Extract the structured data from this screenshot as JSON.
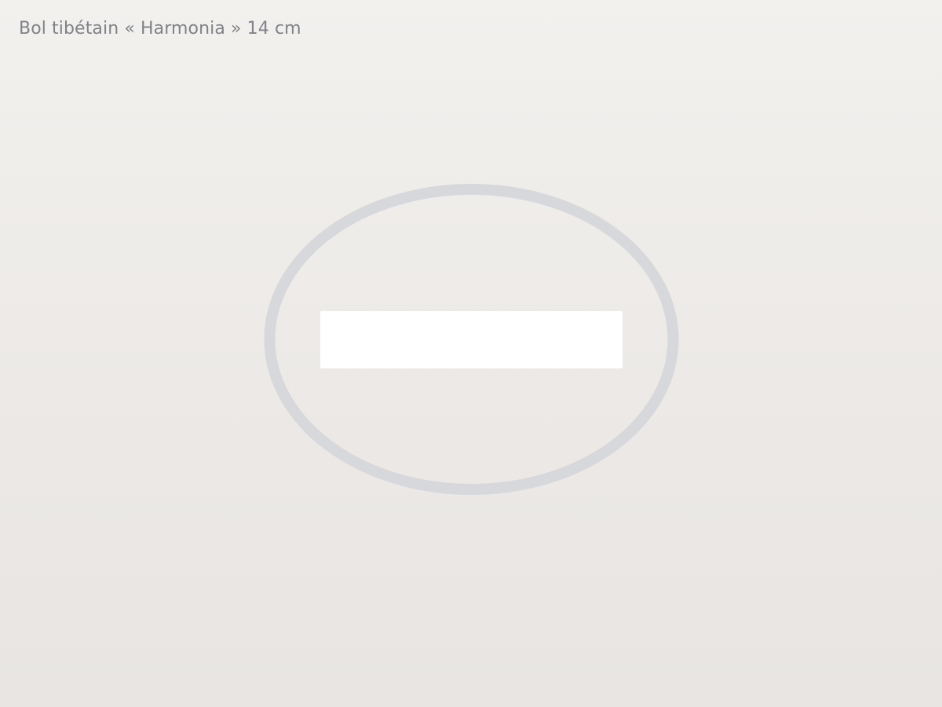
{
  "product": {
    "title": "Bol tibétain « Harmonia » 14 cm"
  },
  "image": {
    "icon": "bowl-outline-icon",
    "stroke_color": "#d6d8db",
    "label_box_color": "#ffffff"
  },
  "colors": {
    "title": "#7f8387",
    "background_top": "#f2f1ee",
    "background_bottom": "#e8e5e2"
  }
}
